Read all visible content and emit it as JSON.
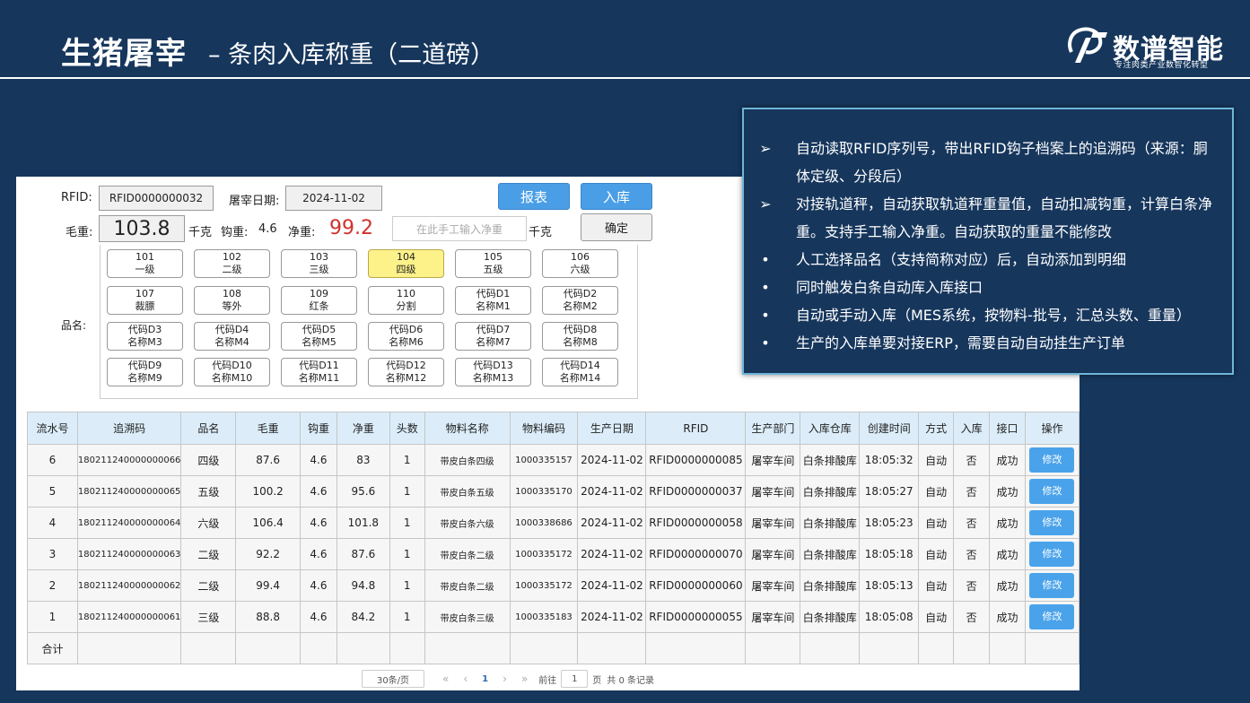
{
  "header": {
    "title_main": "生猪屠宰",
    "title_sub": "– 条肉入库称重（二道磅）",
    "logo_text": "数谱智能",
    "logo_slogan": "专注肉类产业数智化转型"
  },
  "notes": [
    {
      "marker": "➢",
      "text": "自动读取RFID序列号，带出RFID钩子档案上的追溯码（来源：胴体定级、分段后）"
    },
    {
      "marker": "➢",
      "text": "对接轨道秤，自动获取轨道秤重量值，自动扣减钩重，计算白条净重。支持手工输入净重。自动获取的重量不能修改"
    },
    {
      "marker": "•",
      "text": "人工选择品名（支持简称对应）后，自动添加到明细"
    },
    {
      "marker": "•",
      "text": "同时触发白条自动库入库接口"
    },
    {
      "marker": "•",
      "text": "自动或手动入库（MES系统，按物料-批号，汇总头数、重量）"
    },
    {
      "marker": "•",
      "text": "生产的入库单要对接ERP，需要自动自动挂生产订单"
    }
  ],
  "form": {
    "rfid_label": "RFID:",
    "rfid_value": "RFID0000000032",
    "date_label": "屠宰日期:",
    "date_value": "2024-11-02",
    "gross_label": "毛重:",
    "gross_value": "103.8",
    "unit1": "千克",
    "hook_label": "钩重:",
    "hook_value": "4.6",
    "net_label": "净重:",
    "net_value": "99.2",
    "manual_placeholder": "在此手工输入净重",
    "unit2": "千克",
    "report_btn": "报表",
    "stock_btn": "入库",
    "confirm_btn": "确定",
    "grade_label": "品名:"
  },
  "grades": [
    {
      "code": "101",
      "name": "一级"
    },
    {
      "code": "102",
      "name": "二级"
    },
    {
      "code": "103",
      "name": "三级"
    },
    {
      "code": "104",
      "name": "四级",
      "selected": true
    },
    {
      "code": "105",
      "name": "五级"
    },
    {
      "code": "106",
      "name": "六级"
    },
    {
      "code": "107",
      "name": "裁膘"
    },
    {
      "code": "108",
      "name": "等外"
    },
    {
      "code": "109",
      "name": "红条"
    },
    {
      "code": "110",
      "name": "分割"
    },
    {
      "code": "代码D1",
      "name": "名称M1"
    },
    {
      "code": "代码D2",
      "name": "名称M2"
    },
    {
      "code": "代码D3",
      "name": "名称M3"
    },
    {
      "code": "代码D4",
      "name": "名称M4"
    },
    {
      "code": "代码D5",
      "name": "名称M5"
    },
    {
      "code": "代码D6",
      "name": "名称M6"
    },
    {
      "code": "代码D7",
      "name": "名称M7"
    },
    {
      "code": "代码D8",
      "name": "名称M8"
    },
    {
      "code": "代码D9",
      "name": "名称M9"
    },
    {
      "code": "代码D10",
      "name": "名称M10"
    },
    {
      "code": "代码D11",
      "name": "名称M11"
    },
    {
      "code": "代码D12",
      "name": "名称M12"
    },
    {
      "code": "代码D13",
      "name": "名称M13"
    },
    {
      "code": "代码D14",
      "name": "名称M14"
    }
  ],
  "table": {
    "columns": [
      "流水号",
      "追溯码",
      "品名",
      "毛重",
      "钩重",
      "净重",
      "头数",
      "物料名称",
      "物料编码",
      "生产日期",
      "RFID",
      "生产部门",
      "入库仓库",
      "创建时间",
      "方式",
      "入库",
      "接口",
      "操作"
    ],
    "edit_label": "修改",
    "total_label": "合计",
    "rows": [
      [
        "6",
        "180211240000000066",
        "四级",
        "87.6",
        "4.6",
        "83",
        "1",
        "带皮白条四级",
        "1000335157",
        "2024-11-02",
        "RFID0000000085",
        "屠宰车间",
        "白条排酸库",
        "18:05:32",
        "自动",
        "否",
        "成功"
      ],
      [
        "5",
        "180211240000000065",
        "五级",
        "100.2",
        "4.6",
        "95.6",
        "1",
        "带皮白条五级",
        "1000335170",
        "2024-11-02",
        "RFID0000000037",
        "屠宰车间",
        "白条排酸库",
        "18:05:27",
        "自动",
        "否",
        "成功"
      ],
      [
        "4",
        "180211240000000064",
        "六级",
        "106.4",
        "4.6",
        "101.8",
        "1",
        "带皮白条六级",
        "1000338686",
        "2024-11-02",
        "RFID0000000058",
        "屠宰车间",
        "白条排酸库",
        "18:05:23",
        "自动",
        "否",
        "成功"
      ],
      [
        "3",
        "180211240000000063",
        "二级",
        "92.2",
        "4.6",
        "87.6",
        "1",
        "带皮白条二级",
        "1000335172",
        "2024-11-02",
        "RFID0000000070",
        "屠宰车间",
        "白条排酸库",
        "18:05:18",
        "自动",
        "否",
        "成功"
      ],
      [
        "2",
        "180211240000000062",
        "二级",
        "99.4",
        "4.6",
        "94.8",
        "1",
        "带皮白条二级",
        "1000335172",
        "2024-11-02",
        "RFID0000000060",
        "屠宰车间",
        "白条排酸库",
        "18:05:13",
        "自动",
        "否",
        "成功"
      ],
      [
        "1",
        "180211240000000061",
        "三级",
        "88.8",
        "4.6",
        "84.2",
        "1",
        "带皮白条三级",
        "1000335183",
        "2024-11-02",
        "RFID0000000055",
        "屠宰车间",
        "白条排酸库",
        "18:05:08",
        "自动",
        "否",
        "成功"
      ]
    ]
  },
  "pager": {
    "page_size": "30条/页",
    "first": "«",
    "prev": "‹",
    "current": "1",
    "next": "›",
    "last": "»",
    "goto_label": "前往",
    "goto_value": "1",
    "page_unit": "页",
    "total": "共 0 条记录"
  }
}
